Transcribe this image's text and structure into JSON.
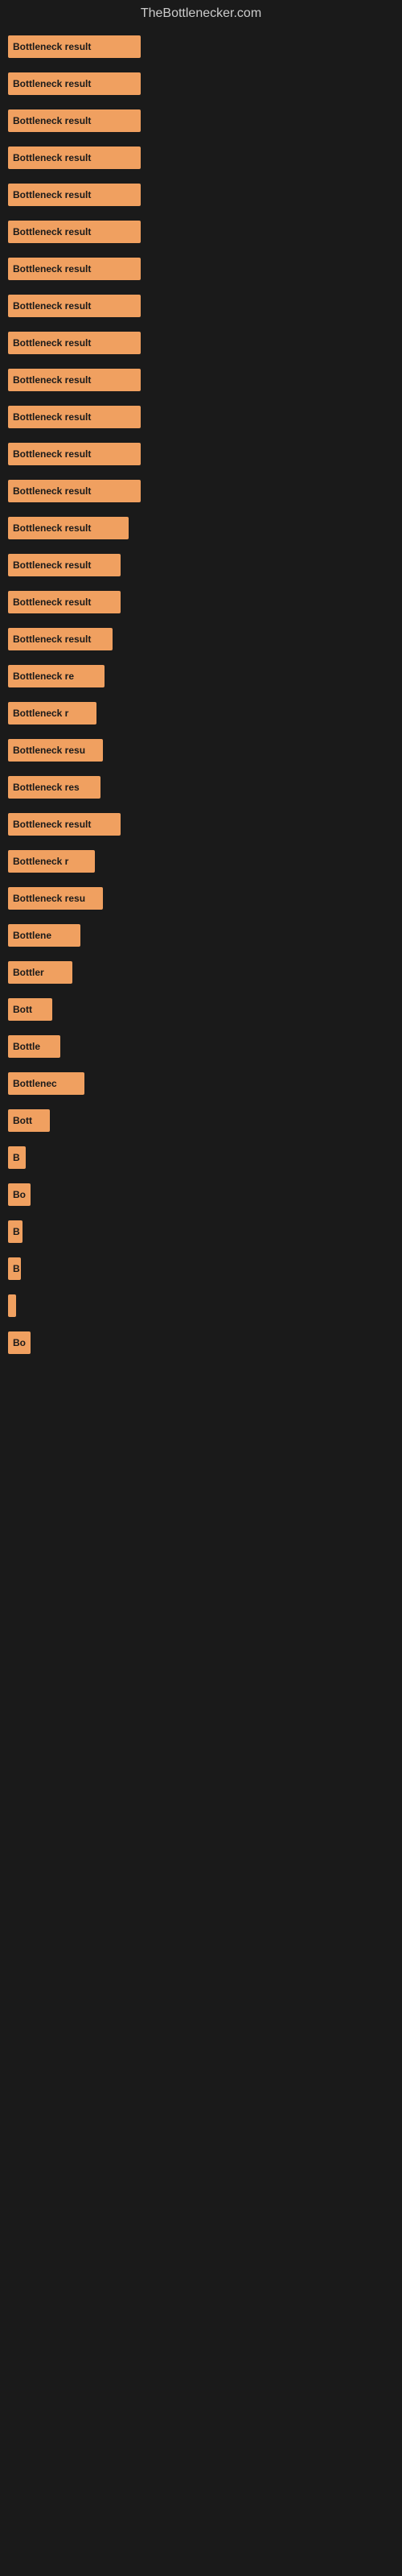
{
  "site": {
    "title": "TheBottlenecker.com"
  },
  "bars": [
    {
      "label": "Bottleneck result",
      "width": 165
    },
    {
      "label": "Bottleneck result",
      "width": 165
    },
    {
      "label": "Bottleneck result",
      "width": 165
    },
    {
      "label": "Bottleneck result",
      "width": 165
    },
    {
      "label": "Bottleneck result",
      "width": 165
    },
    {
      "label": "Bottleneck result",
      "width": 165
    },
    {
      "label": "Bottleneck result",
      "width": 165
    },
    {
      "label": "Bottleneck result",
      "width": 165
    },
    {
      "label": "Bottleneck result",
      "width": 165
    },
    {
      "label": "Bottleneck result",
      "width": 165
    },
    {
      "label": "Bottleneck result",
      "width": 165
    },
    {
      "label": "Bottleneck result",
      "width": 165
    },
    {
      "label": "Bottleneck result",
      "width": 165
    },
    {
      "label": "Bottleneck result",
      "width": 150
    },
    {
      "label": "Bottleneck result",
      "width": 140
    },
    {
      "label": "Bottleneck result",
      "width": 140
    },
    {
      "label": "Bottleneck result",
      "width": 130
    },
    {
      "label": "Bottleneck re",
      "width": 120
    },
    {
      "label": "Bottleneck r",
      "width": 110
    },
    {
      "label": "Bottleneck resu",
      "width": 118
    },
    {
      "label": "Bottleneck res",
      "width": 115
    },
    {
      "label": "Bottleneck result",
      "width": 140
    },
    {
      "label": "Bottleneck r",
      "width": 108
    },
    {
      "label": "Bottleneck resu",
      "width": 118
    },
    {
      "label": "Bottlene",
      "width": 90
    },
    {
      "label": "Bottler",
      "width": 80
    },
    {
      "label": "Bott",
      "width": 55
    },
    {
      "label": "Bottle",
      "width": 65
    },
    {
      "label": "Bottlenec",
      "width": 95
    },
    {
      "label": "Bott",
      "width": 52
    },
    {
      "label": "B",
      "width": 22
    },
    {
      "label": "Bo",
      "width": 28
    },
    {
      "label": "B",
      "width": 18
    },
    {
      "label": "B",
      "width": 16
    },
    {
      "label": "",
      "width": 10
    },
    {
      "label": "Bo",
      "width": 28
    }
  ]
}
